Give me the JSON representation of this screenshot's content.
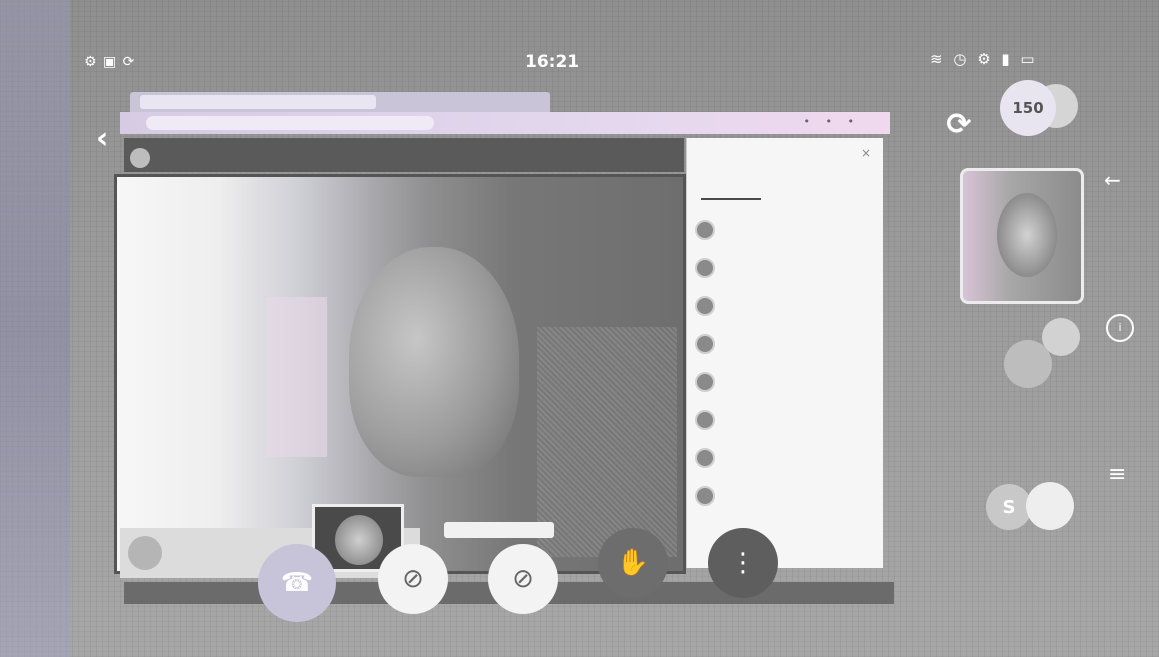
{
  "status_bar": {
    "left_icons": "⚙ ▣ ⟳",
    "time": "16:21",
    "right_icons": "≋ ◷ ⚙ ▮ ▭"
  },
  "browser": {
    "tab_title": "",
    "url": "",
    "menu_dots": "• • •"
  },
  "meeting": {
    "title": "",
    "subtitle": ""
  },
  "self_view": {
    "name": ""
  },
  "participants_panel": {
    "title": "",
    "close": "×",
    "tab_label": "",
    "count": "",
    "rows": [
      {
        "name": "",
        "status": ""
      },
      {
        "name": "",
        "status": ""
      },
      {
        "name": "",
        "status": ""
      },
      {
        "name": "",
        "status": ""
      },
      {
        "name": "",
        "status": ""
      },
      {
        "name": "",
        "status": ""
      },
      {
        "name": "",
        "status": ""
      },
      {
        "name": "",
        "status": ""
      }
    ]
  },
  "controls": {
    "end_icon": "☎",
    "camera_icon": "⊘",
    "mic_icon": "⊘",
    "hand_icon": "✋",
    "more_icon": "⋮"
  },
  "right_rail": {
    "sync_icon": "⟳",
    "bubble_top": "150",
    "bubble_top_label": "",
    "side_arrow": "←",
    "side_num": "",
    "ring_icon": "i",
    "bubble_mid_label": "",
    "menu_icon": "≡",
    "bubble_s": "S",
    "bubble_s2": "",
    "bubble_bottom_label": ""
  },
  "bottom_bar": {
    "text": ""
  }
}
